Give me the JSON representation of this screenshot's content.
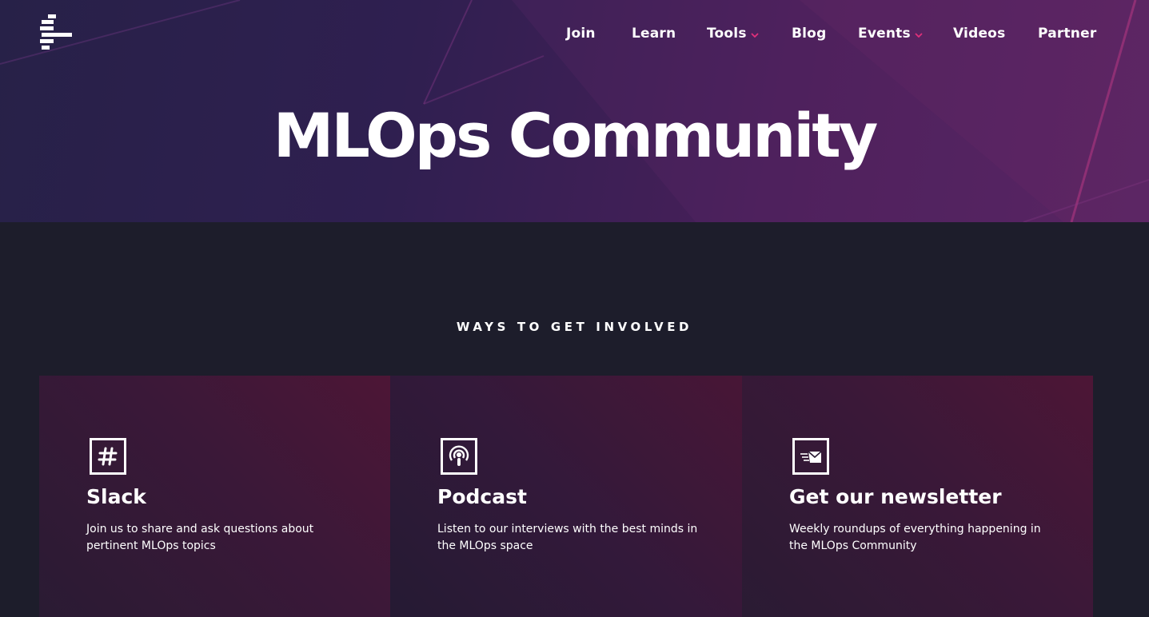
{
  "nav": {
    "items": [
      {
        "label": "Join",
        "has_dropdown": false
      },
      {
        "label": "Learn",
        "has_dropdown": false
      },
      {
        "label": "Tools",
        "has_dropdown": true
      },
      {
        "label": "Blog",
        "has_dropdown": false
      },
      {
        "label": "Events",
        "has_dropdown": true
      },
      {
        "label": "Videos",
        "has_dropdown": false
      },
      {
        "label": "Partner",
        "has_dropdown": false
      }
    ]
  },
  "hero": {
    "title": "MLOps Community"
  },
  "involved": {
    "heading": "WAYS TO GET INVOLVED",
    "cards": [
      {
        "icon": "slack-hash-icon",
        "title": "Slack",
        "description": "Join us to share and ask questions about pertinent MLOps topics"
      },
      {
        "icon": "podcast-icon",
        "title": "Podcast",
        "description": "Listen to our interviews with the best minds in the MLOps space"
      },
      {
        "icon": "newsletter-icon",
        "title": "Get our newsletter",
        "description": "Weekly roundups of everything happening in the MLOps Community"
      }
    ]
  },
  "colors": {
    "hero_gradient_start": "#272148",
    "hero_gradient_end": "#552461",
    "page_background": "#1d1d2b",
    "card_accent": "#4d1636",
    "dropdown_chevron": "#e0307a"
  }
}
